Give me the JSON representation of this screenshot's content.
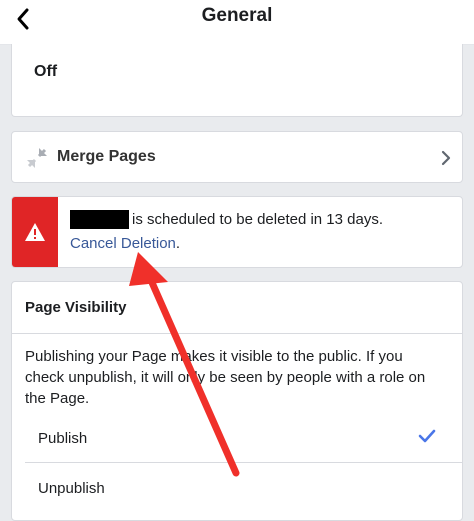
{
  "header": {
    "title": "General",
    "back_icon": "chevron-left-icon"
  },
  "off_card": {
    "label": "Off"
  },
  "merge": {
    "label": "Merge Pages",
    "icon": "merge-icon"
  },
  "warning": {
    "text": "is scheduled to be deleted in 13 days.",
    "cancel_label": "Cancel Deletion",
    "cancel_suffix": ".",
    "stripe_color": "#e02526",
    "link_color": "#385898"
  },
  "visibility": {
    "title": "Page Visibility",
    "description": "Publishing your Page makes it visible to the public. If you check unpublish, it will only be seen by people with a role on the Page.",
    "options": [
      {
        "label": "Publish",
        "selected": true
      },
      {
        "label": "Unpublish",
        "selected": false
      }
    ],
    "check_color": "#4a76e8"
  },
  "annotation": {
    "arrow_color": "#f0302a"
  }
}
